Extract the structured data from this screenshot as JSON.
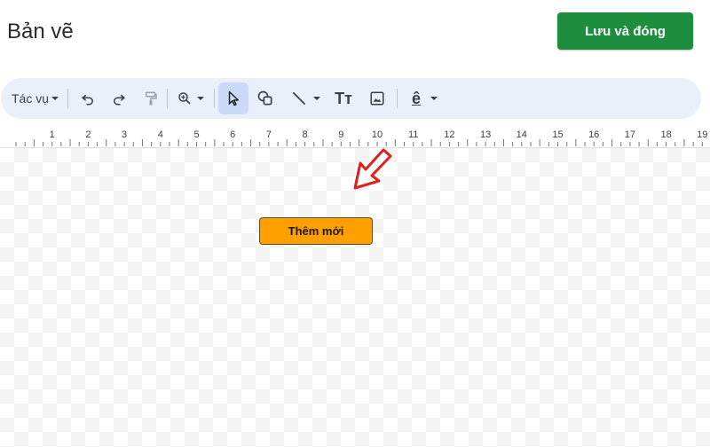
{
  "header": {
    "title": "Bản vẽ",
    "save_button": "Lưu và đóng"
  },
  "toolbar": {
    "actions_label": "Tác vụ",
    "items": [
      {
        "icon": "undo-icon"
      },
      {
        "icon": "redo-icon"
      },
      {
        "icon": "paint-format-icon"
      },
      {
        "icon": "zoom-icon"
      },
      {
        "icon": "select-cursor-icon",
        "active": true
      },
      {
        "icon": "shape-icon"
      },
      {
        "icon": "line-icon"
      },
      {
        "icon": "text-box-icon",
        "label": "Tт"
      },
      {
        "icon": "image-icon"
      },
      {
        "icon": "word-art-icon",
        "label": "ê"
      }
    ]
  },
  "ruler": {
    "ticks": [
      "1",
      "2",
      "3",
      "4",
      "5",
      "6",
      "7",
      "8",
      "9",
      "10",
      "11",
      "12",
      "13",
      "14",
      "15",
      "16",
      "17",
      "18",
      "19"
    ]
  },
  "canvas": {
    "shape_label": "Thêm mới",
    "shape_color": "#ff9f00",
    "annotation": "red-arrow-icon"
  },
  "colors": {
    "accent": "#1e8e3e",
    "toolbar_bg": "#eaf0fa",
    "active_tool": "#c9daf8"
  }
}
